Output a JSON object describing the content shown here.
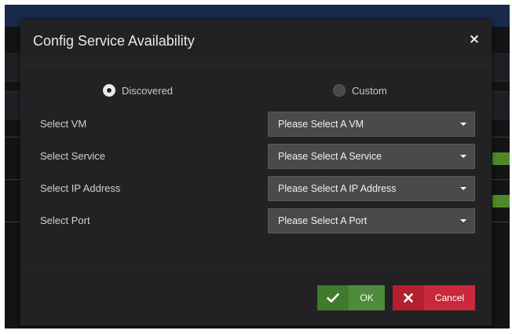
{
  "modal": {
    "title": "Config Service Availability",
    "close_glyph": "×"
  },
  "mode": {
    "options": [
      {
        "label": "Discovered",
        "selected": true
      },
      {
        "label": "Custom",
        "selected": false
      }
    ]
  },
  "form": {
    "fields": [
      {
        "label": "Select VM",
        "value": "Please Select A VM"
      },
      {
        "label": "Select Service",
        "value": "Please Select A Service"
      },
      {
        "label": "Select IP Address",
        "value": "Please Select A IP Address"
      },
      {
        "label": "Select Port",
        "value": "Please Select A Port"
      }
    ]
  },
  "footer": {
    "ok_label": "OK",
    "ok_icon": "check-icon",
    "cancel_label": "Cancel",
    "cancel_icon": "x-icon"
  },
  "colors": {
    "ok": "#4e8b3a",
    "cancel": "#c9293a",
    "modal_bg": "#222224"
  }
}
